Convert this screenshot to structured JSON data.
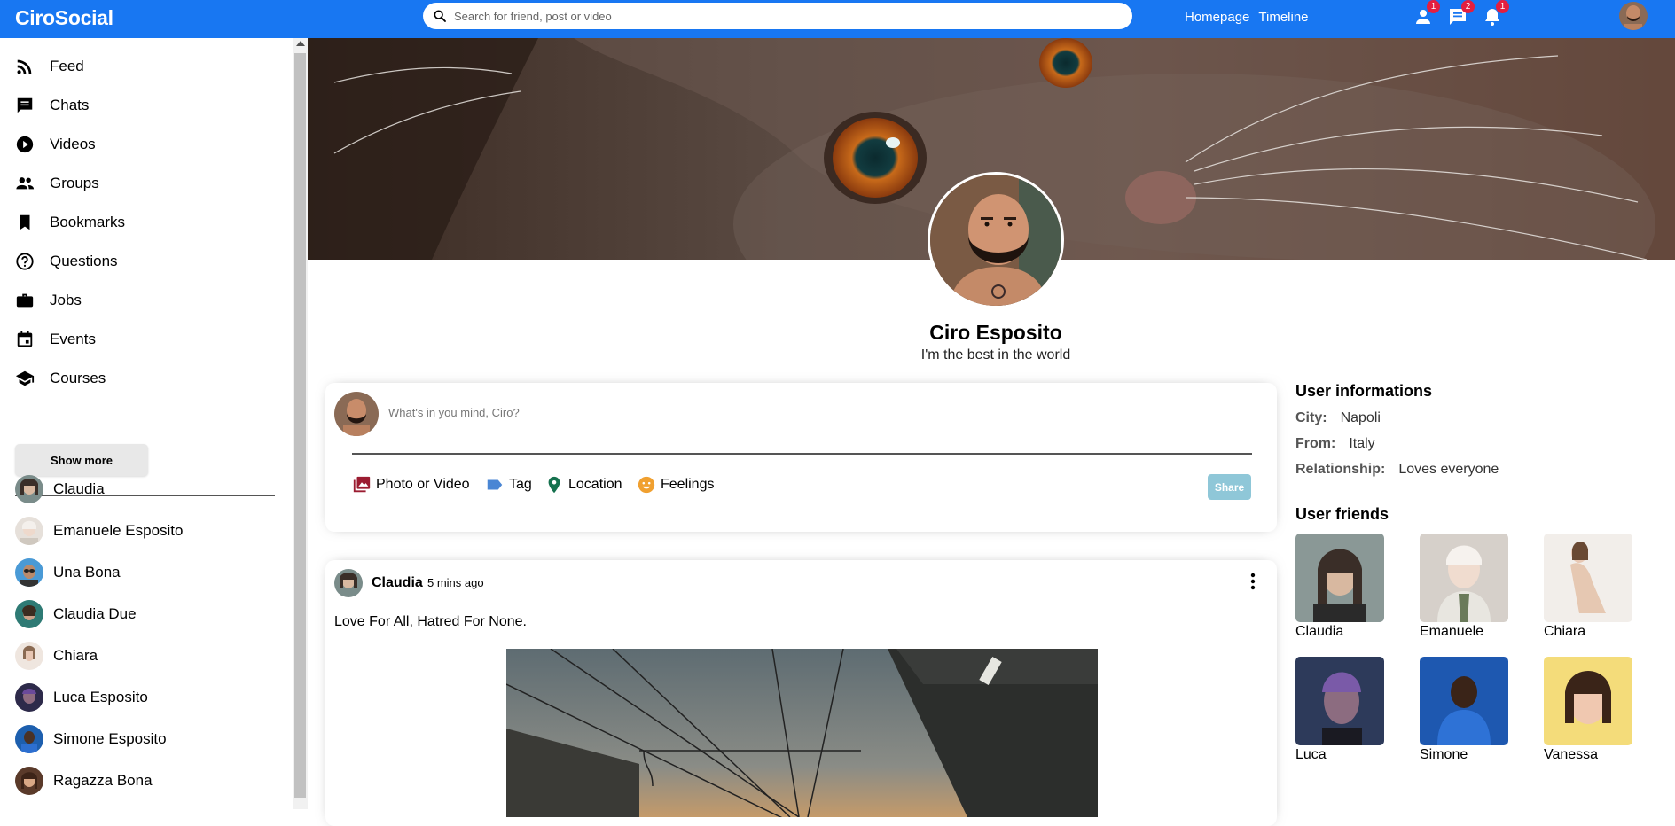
{
  "topbar": {
    "logo": "CiroSocial",
    "search_placeholder": "Search for friend, post or video",
    "links": [
      "Homepage",
      "Timeline"
    ],
    "badges": {
      "person": "1",
      "chat": "2",
      "notifications": "1"
    }
  },
  "sidebar": {
    "items": [
      {
        "label": "Feed",
        "icon": "rss-feed-icon"
      },
      {
        "label": "Chats",
        "icon": "chat-icon"
      },
      {
        "label": "Videos",
        "icon": "play-circle-icon"
      },
      {
        "label": "Groups",
        "icon": "group-icon"
      },
      {
        "label": "Bookmarks",
        "icon": "bookmark-icon"
      },
      {
        "label": "Questions",
        "icon": "help-outline-icon"
      },
      {
        "label": "Jobs",
        "icon": "work-icon"
      },
      {
        "label": "Events",
        "icon": "event-icon"
      },
      {
        "label": "Courses",
        "icon": "school-icon"
      }
    ],
    "show_more": "Show more",
    "friends": [
      "Claudia",
      "Emanuele Esposito",
      "Una Bona",
      "Claudia Due",
      "Chiara",
      "Luca Esposito",
      "Simone Esposito",
      "Ragazza Bona"
    ]
  },
  "profile": {
    "name": "Ciro Esposito",
    "desc": "I'm the best in the world"
  },
  "share": {
    "placeholder": "What's in you mind, Ciro?",
    "options": [
      "Photo or Video",
      "Tag",
      "Location",
      "Feelings"
    ],
    "button": "Share"
  },
  "post": {
    "user": "Claudia",
    "time": "5 mins ago",
    "text": "Love For All, Hatred For None."
  },
  "rightbar": {
    "info_title": "User informations",
    "info": [
      {
        "key": "City:",
        "value": "Napoli"
      },
      {
        "key": "From:",
        "value": "Italy"
      },
      {
        "key": "Relationship:",
        "value": "Loves everyone"
      }
    ],
    "friends_title": "User friends",
    "friends": [
      "Claudia",
      "Emanuele",
      "Chiara",
      "Luca",
      "Simone",
      "Vanessa"
    ]
  },
  "colors": {
    "topbar": "#1877f2",
    "badge": "#e41e3f",
    "share_button": "#8fc7d8"
  }
}
